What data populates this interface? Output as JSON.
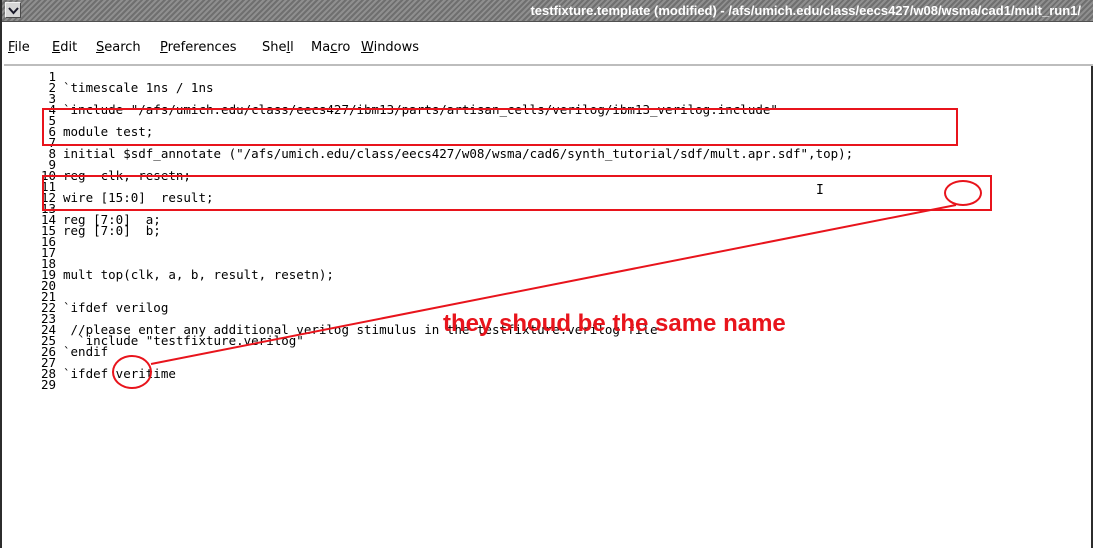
{
  "window": {
    "title": "testfixture.template (modified) - /afs/umich.edu/class/eecs427/w08/wsma/cad1/mult_run1/"
  },
  "menu": [
    "File",
    "Edit",
    "Search",
    "Preferences",
    "Shell",
    "Macro",
    "Windows"
  ],
  "editor": {
    "lines": [
      {
        "n": "1",
        "text": ""
      },
      {
        "n": "2",
        "text": "`timescale 1ns / 1ns"
      },
      {
        "n": "3",
        "text": ""
      },
      {
        "n": "4",
        "text": "`include \"/afs/umich.edu/class/eecs427/ibm13/parts/artisan_cells/verilog/ibm13_verilog.include\""
      },
      {
        "n": "5",
        "text": ""
      },
      {
        "n": "6",
        "text": "module test;"
      },
      {
        "n": "7",
        "text": ""
      },
      {
        "n": "8",
        "text": "initial $sdf_annotate (\"/afs/umich.edu/class/eecs427/w08/wsma/cad6/synth_tutorial/sdf/mult.apr.sdf\",top);"
      },
      {
        "n": "9",
        "text": ""
      },
      {
        "n": "10",
        "text": "reg  clk, resetn;"
      },
      {
        "n": "11",
        "text": ""
      },
      {
        "n": "12",
        "text": "wire [15:0]  result;"
      },
      {
        "n": "13",
        "text": ""
      },
      {
        "n": "14",
        "text": "reg [7:0]  a;"
      },
      {
        "n": "15",
        "text": "reg [7:0]  b;"
      },
      {
        "n": "16",
        "text": ""
      },
      {
        "n": "17",
        "text": ""
      },
      {
        "n": "18",
        "text": ""
      },
      {
        "n": "19",
        "text": "mult top(clk, a, b, result, resetn);"
      },
      {
        "n": "20",
        "text": ""
      },
      {
        "n": "21",
        "text": ""
      },
      {
        "n": "22",
        "text": "`ifdef verilog"
      },
      {
        "n": "23",
        "text": ""
      },
      {
        "n": "24",
        "text": " //please enter any additional verilog stimulus in the testfixture.verilog file"
      },
      {
        "n": "25",
        "text": "  `include \"testfixture.verilog\""
      },
      {
        "n": "26",
        "text": "`endif"
      },
      {
        "n": "27",
        "text": ""
      },
      {
        "n": "28",
        "text": "`ifdef veritime"
      },
      {
        "n": "29",
        "text": ""
      }
    ]
  },
  "annotation": {
    "note": "they shoud be the same name",
    "color": "#e8141c"
  },
  "icons": {
    "window_menu": "chevron-down-icon",
    "text_cursor": "i-beam-cursor-icon"
  }
}
